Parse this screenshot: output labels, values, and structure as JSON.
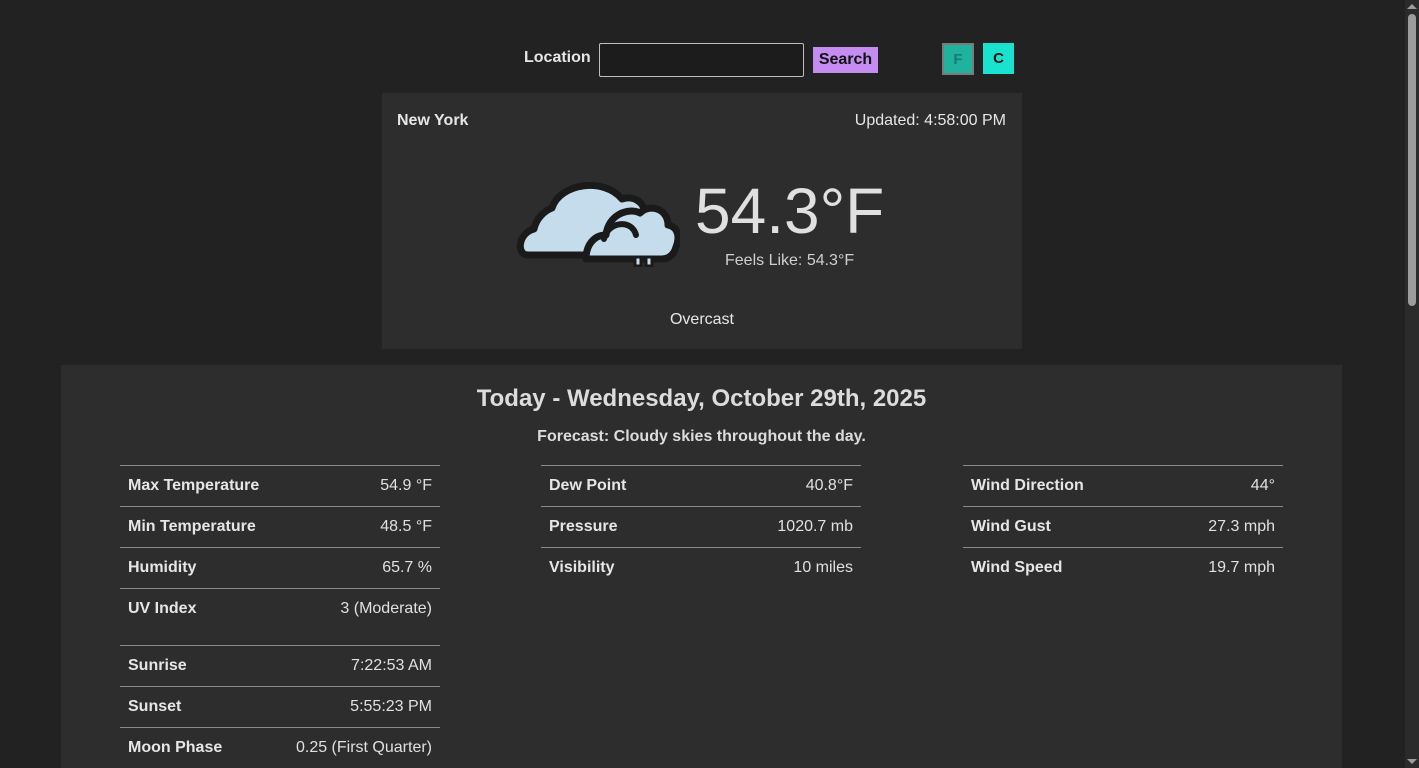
{
  "search": {
    "label": "Location",
    "value": "",
    "button_label": "Search"
  },
  "units": {
    "f_label": "F",
    "c_label": "C",
    "selected": "F"
  },
  "current": {
    "city": "New York",
    "updated": "Updated: 4:58:00 PM",
    "temperature": "54.3°F",
    "feels_like": "Feels Like: 54.3°F",
    "condition": "Overcast",
    "icon": "overcast-cloud-icon"
  },
  "today": {
    "title": "Today - Wednesday, October 29th, 2025",
    "forecast": "Forecast: Cloudy skies throughout the day.",
    "columns": [
      [
        {
          "label": "Max Temperature",
          "value": "54.9 °F"
        },
        {
          "label": "Min Temperature",
          "value": "48.5 °F"
        },
        {
          "label": "Humidity",
          "value": "65.7 %"
        },
        {
          "label": "UV Index",
          "value": "3 (Moderate)"
        },
        {
          "label": "Sunrise",
          "value": "7:22:53 AM"
        },
        {
          "label": "Sunset",
          "value": "5:55:23 PM"
        },
        {
          "label": "Moon Phase",
          "value": "0.25 (First Quarter)"
        }
      ],
      [
        {
          "label": "Dew Point",
          "value": "40.8°F"
        },
        {
          "label": "Pressure",
          "value": "1020.7 mb"
        },
        {
          "label": "Visibility",
          "value": "10 miles"
        }
      ],
      [
        {
          "label": "Wind Direction",
          "value": "44°"
        },
        {
          "label": "Wind Gust",
          "value": "27.3 mph"
        },
        {
          "label": "Wind Speed",
          "value": "19.7 mph"
        }
      ]
    ]
  },
  "colors": {
    "background": "#222222",
    "card": "#2d2d2d",
    "search_button": "#c58df2",
    "unit_f": "#1fb39e",
    "unit_c": "#19e3cf",
    "cloud_fill": "#c5dcec"
  }
}
